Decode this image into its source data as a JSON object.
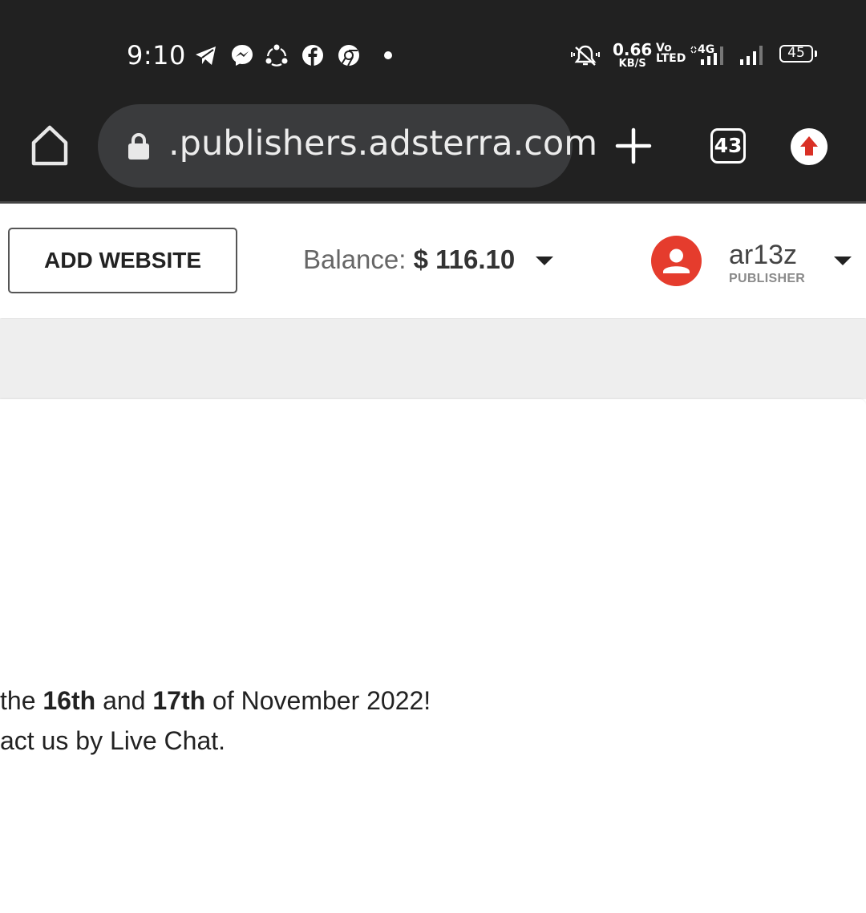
{
  "status_bar": {
    "time": "9:10",
    "notification_icons": [
      "telegram-icon",
      "messenger-icon",
      "share-icon",
      "facebook-icon",
      "chrome-icon"
    ],
    "net_speed_value": "0.66",
    "net_speed_unit": "KB/S",
    "volte_top": "Vo",
    "volte_bottom": "LTED",
    "network_type": "4G",
    "battery": "45"
  },
  "browser": {
    "url": ".publishers.adsterra.com",
    "tab_count": "43"
  },
  "header": {
    "add_website_label": "ADD WEBSITE",
    "balance_label": "Balance:",
    "balance_amount": "$ 116.10",
    "user_name": "ar13z",
    "user_role": "PUBLISHER",
    "colors": {
      "avatar": "#e53c2d",
      "update_arrow": "#d93025"
    }
  },
  "notice": {
    "line1_part1": "the ",
    "line1_bold1": "16th",
    "line1_part2": " and ",
    "line1_bold2": "17th",
    "line1_part3": " of November 2022!",
    "line2": "act us by Live Chat."
  }
}
